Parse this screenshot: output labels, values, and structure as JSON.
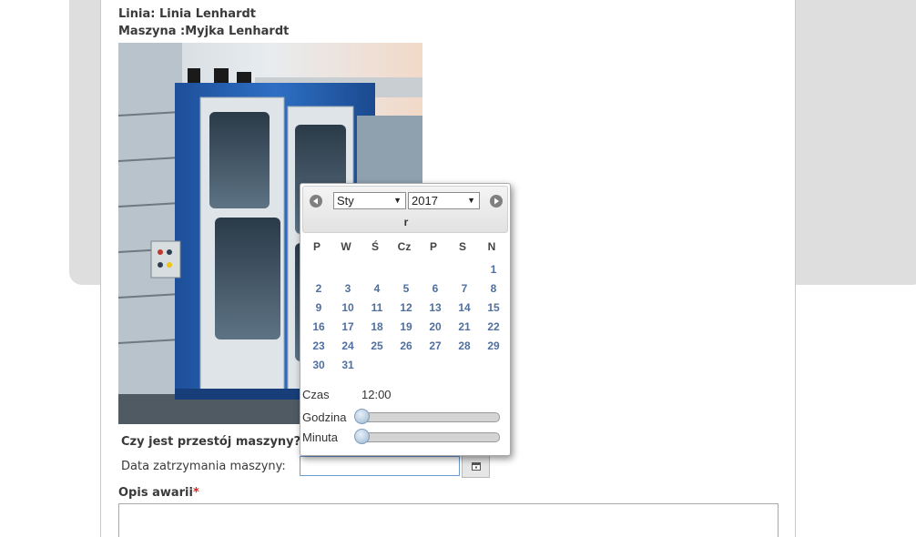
{
  "header": {
    "linia": "Linia: Linia Lenhardt",
    "maszyna": "Maszyna :Myjka Lenhardt"
  },
  "form": {
    "przestoj_label": "Czy jest przestój maszyny?",
    "required_mark": "*",
    "data_label": "Data zatrzymania maszyny:",
    "data_value": "",
    "opis_label": "Opis awarii",
    "opis_value": ""
  },
  "datepicker": {
    "month_selected": "Sty",
    "year_selected": "2017",
    "header_text": "r",
    "weekdays": [
      "P",
      "W",
      "Ś",
      "Cz",
      "P",
      "S",
      "N"
    ],
    "days": [
      [
        "",
        "",
        "",
        "",
        "",
        "",
        "1"
      ],
      [
        "2",
        "3",
        "4",
        "5",
        "6",
        "7",
        "8"
      ],
      [
        "9",
        "10",
        "11",
        "12",
        "13",
        "14",
        "15"
      ],
      [
        "16",
        "17",
        "18",
        "19",
        "20",
        "21",
        "22"
      ],
      [
        "23",
        "24",
        "25",
        "26",
        "27",
        "28",
        "29"
      ],
      [
        "30",
        "31",
        "",
        "",
        "",
        "",
        ""
      ]
    ],
    "time_label": "Czas",
    "time_value": "12:00",
    "hour_label": "Godzina",
    "minute_label": "Minuta",
    "hour_level": 0,
    "minute_level": 0
  },
  "icons": {
    "prev": "chevron-left-icon",
    "next": "chevron-right-icon",
    "calendar": "calendar-icon"
  },
  "colors": {
    "day_link": "#4f6fa0",
    "required": "#d9261c",
    "input_focus_border": "#6a9ad0"
  }
}
